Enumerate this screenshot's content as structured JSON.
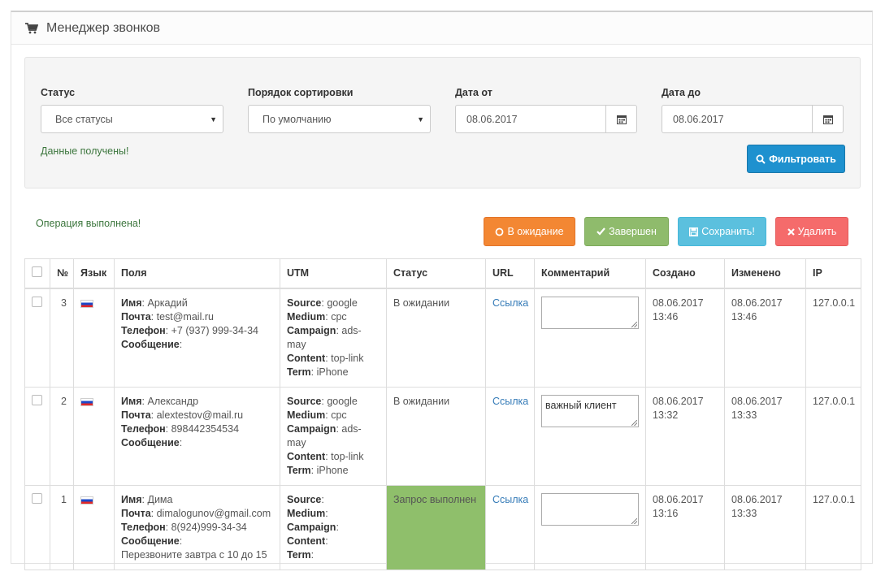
{
  "header": {
    "title": "Менеджер звонков",
    "icon": "cart-icon"
  },
  "filter": {
    "status_label": "Статус",
    "status_value": "Все статусы",
    "sort_label": "Порядок сортировки",
    "sort_value": "По умолчанию",
    "date_from_label": "Дата от",
    "date_from_value": "08.06.2017",
    "date_to_label": "Дата до",
    "date_to_value": "08.06.2017",
    "message": "Данные получены!",
    "filter_button": "Фильтровать"
  },
  "actions": {
    "message": "Операция выполнена!",
    "wait_button": "В ожидание",
    "done_button": "Завершен",
    "save_button": "Сохранить!",
    "delete_button": "Удалить"
  },
  "colors": {
    "primary": "#1e91cf",
    "wait": "#f38733",
    "done": "#8fbb6c",
    "save": "#5bc0de",
    "delete": "#f56b6b",
    "status_done_cell": "#8fbf6b"
  },
  "table": {
    "headers": [
      "№",
      "Язык",
      "Поля",
      "UTM",
      "Статус",
      "URL",
      "Комментарий",
      "Создано",
      "Изменено",
      "IP"
    ],
    "field_labels": {
      "name": "Имя",
      "email": "Почта",
      "phone": "Телефон",
      "message": "Сообщение"
    },
    "utm_labels": {
      "source": "Source",
      "medium": "Medium",
      "campaign": "Campaign",
      "content": "Content",
      "term": "Term"
    },
    "rows": [
      {
        "num": "3",
        "lang_icon": "russia-flag-icon",
        "name": "Аркадий",
        "email": "test@mail.ru",
        "phone": "+7 (937) 999-34-34",
        "message": "",
        "source": "google",
        "medium": "cpc",
        "campaign": "ads-may",
        "content": "top-link",
        "term": "iPhone",
        "status": "В ожидании",
        "url": "Ссылка",
        "comment": "",
        "created_date": "08.06.2017",
        "created_time": "13:46",
        "modified_date": "08.06.2017",
        "modified_time": "13:46",
        "ip": "127.0.0.1"
      },
      {
        "num": "2",
        "lang_icon": "russia-flag-icon",
        "name": "Александр",
        "email": "alextestov@mail.ru",
        "phone": "898442354534",
        "message": "",
        "source": "google",
        "medium": "cpc",
        "campaign": "ads-may",
        "content": "top-link",
        "term": "iPhone",
        "status": "В ожидании",
        "url": "Ссылка",
        "comment": "важный клиент",
        "created_date": "08.06.2017",
        "created_time": "13:32",
        "modified_date": "08.06.2017",
        "modified_time": "13:33",
        "ip": "127.0.0.1"
      },
      {
        "num": "1",
        "lang_icon": "russia-flag-icon",
        "name": "Дима",
        "email": "dimalogunov@gmail.com",
        "phone": "8(924)999-34-34",
        "message": "Перезвоните завтра с 10 до 15",
        "source": "",
        "medium": "",
        "campaign": "",
        "content": "",
        "term": "",
        "status": "Запрос выполнен",
        "url": "Ссылка",
        "comment": "",
        "created_date": "08.06.2017",
        "created_time": "13:16",
        "modified_date": "08.06.2017",
        "modified_time": "13:33",
        "ip": "127.0.0.1"
      }
    ]
  }
}
